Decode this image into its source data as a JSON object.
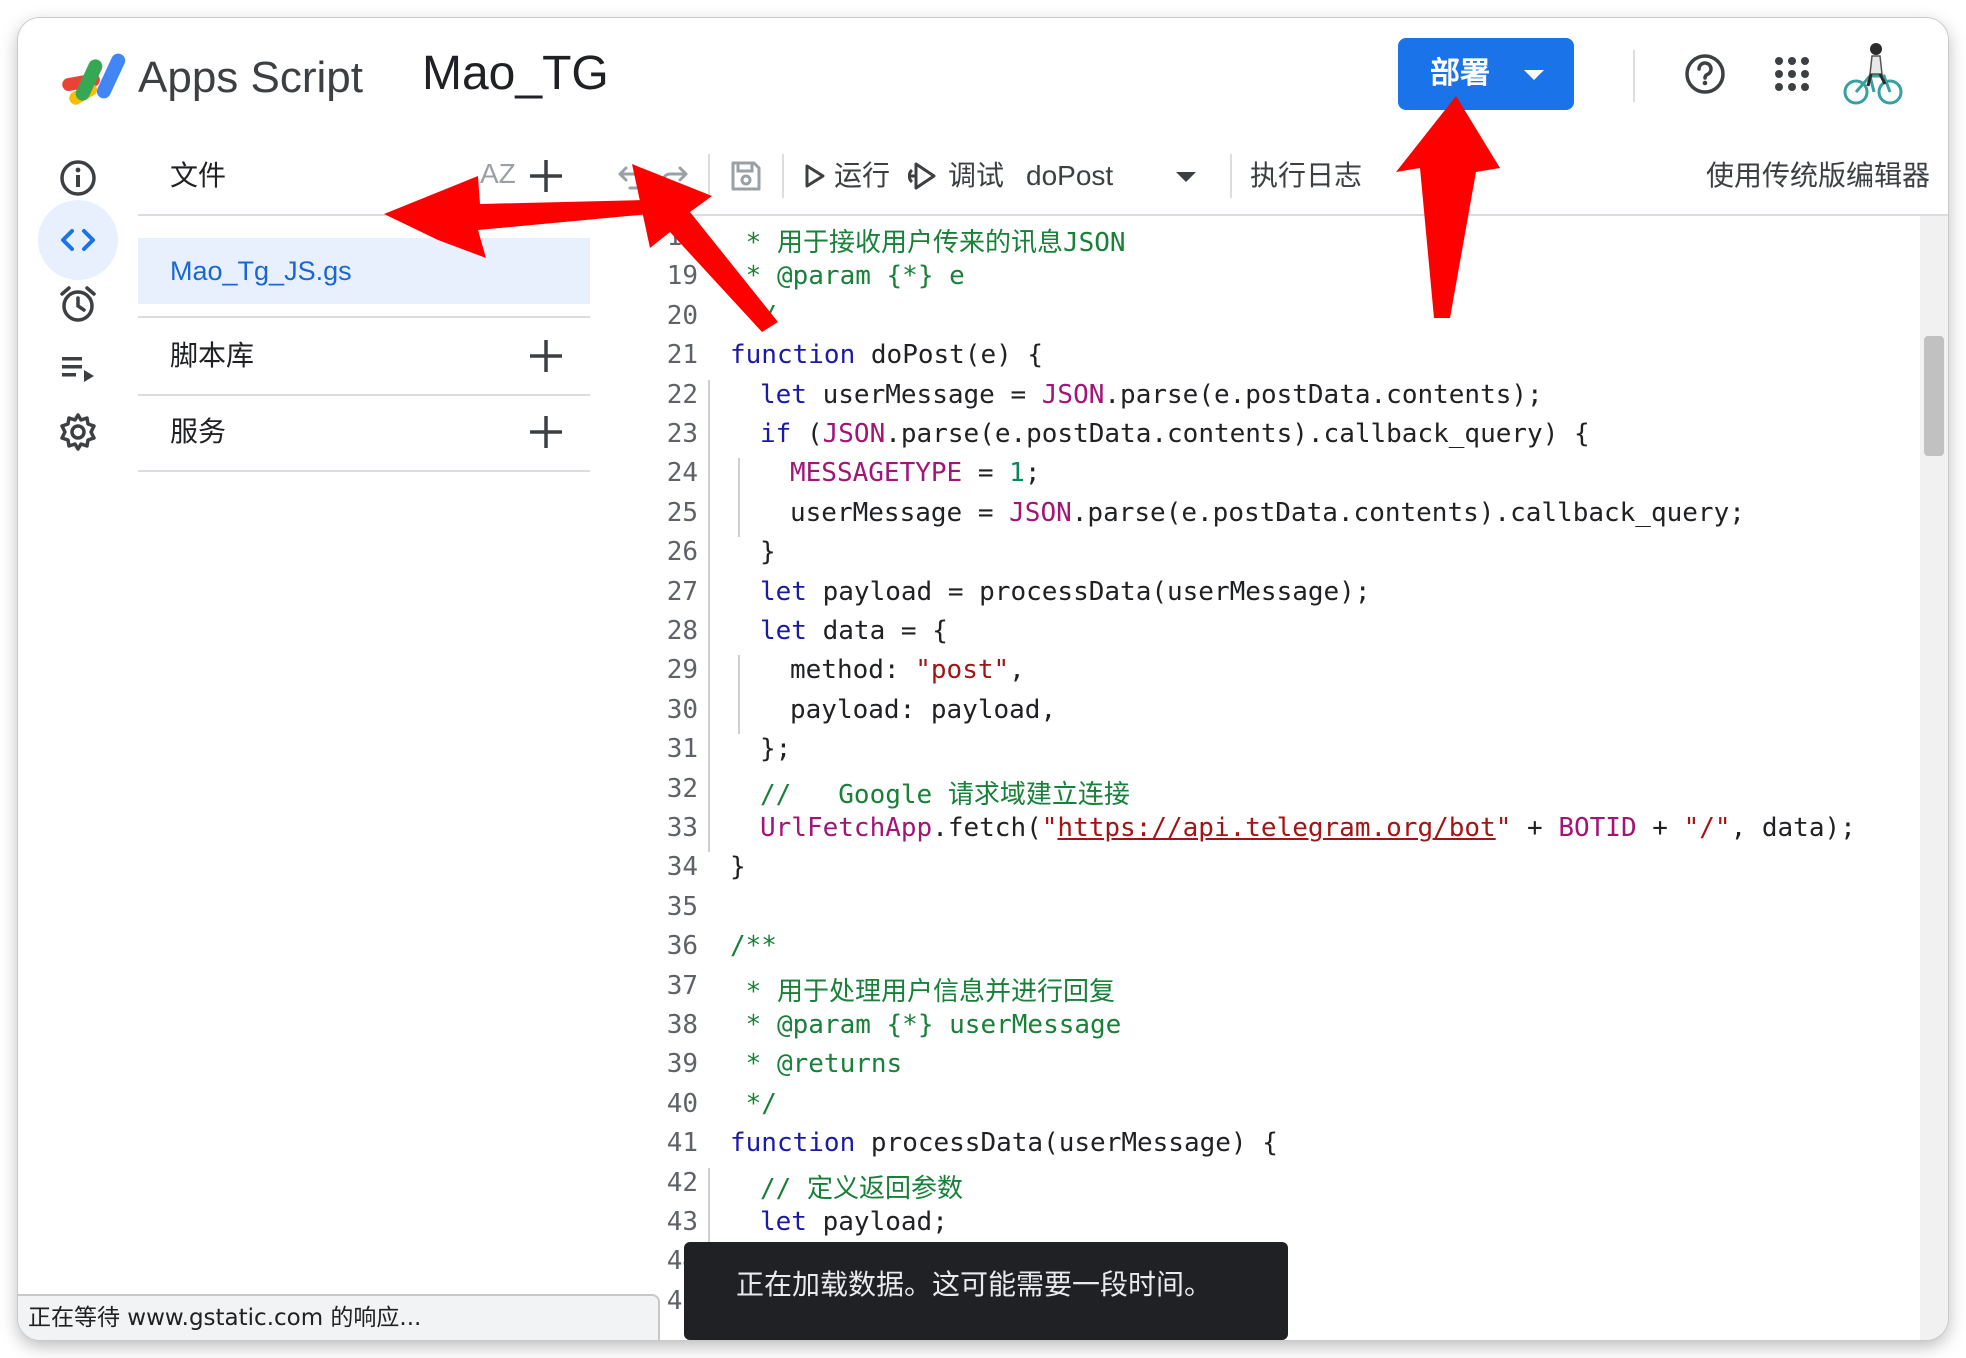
{
  "header": {
    "app_name": "Apps Script",
    "project_name": "Mao_TG",
    "deploy_label": "部署",
    "brand_color": "#1a73e8",
    "icons": [
      "apps-script-logo",
      "deploy-dropdown-icon",
      "help-icon",
      "apps-grid-icon",
      "avatar"
    ]
  },
  "rail": {
    "items": [
      {
        "name": "overview",
        "icon": "info-icon"
      },
      {
        "name": "editor",
        "icon": "code-icon",
        "active": true
      },
      {
        "name": "triggers",
        "icon": "alarm-icon"
      },
      {
        "name": "executions",
        "icon": "executions-icon"
      },
      {
        "name": "settings",
        "icon": "gear-icon"
      }
    ]
  },
  "files": {
    "title": "文件",
    "sort_label": "AZ",
    "items": [
      {
        "name": "Mao_Tg_JS.gs",
        "selected": true
      }
    ],
    "libraries_label": "脚本库",
    "services_label": "服务"
  },
  "toolbar": {
    "run_label": "运行",
    "debug_label": "调试",
    "function_select": "doPost",
    "logs_label": "执行日志",
    "legacy_label": "使用传统版编辑器"
  },
  "editor": {
    "lines": [
      {
        "n": "18",
        "indent": 0,
        "segments": [
          {
            "t": " * 用于接收用户传来的讯息JSON",
            "c": "gr"
          }
        ]
      },
      {
        "n": "19",
        "indent": 0,
        "segments": [
          {
            "t": " * @param {*} e",
            "c": "gr"
          }
        ]
      },
      {
        "n": "20",
        "indent": 0,
        "segments": [
          {
            "t": " */",
            "c": "gr"
          }
        ]
      },
      {
        "n": "21",
        "indent": 0,
        "segments": [
          {
            "t": "function",
            "c": "kw"
          },
          {
            "t": " doPost(e) {",
            "c": ""
          }
        ]
      },
      {
        "n": "22",
        "indent": 1,
        "segments": [
          {
            "t": "let",
            "c": "kw"
          },
          {
            "t": " userMessage = ",
            "c": ""
          },
          {
            "t": "JSON",
            "c": "mg"
          },
          {
            "t": ".parse(e.postData.contents);",
            "c": ""
          }
        ]
      },
      {
        "n": "23",
        "indent": 1,
        "segments": [
          {
            "t": "if",
            "c": "kw"
          },
          {
            "t": " (",
            "c": ""
          },
          {
            "t": "JSON",
            "c": "mg"
          },
          {
            "t": ".parse(e.postData.contents).callback_query) {",
            "c": ""
          }
        ]
      },
      {
        "n": "24",
        "indent": 2,
        "segments": [
          {
            "t": "MESSAGETYPE",
            "c": "mg"
          },
          {
            "t": " = ",
            "c": ""
          },
          {
            "t": "1",
            "c": "nm"
          },
          {
            "t": ";",
            "c": ""
          }
        ]
      },
      {
        "n": "25",
        "indent": 2,
        "segments": [
          {
            "t": "userMessage = ",
            "c": ""
          },
          {
            "t": "JSON",
            "c": "mg"
          },
          {
            "t": ".parse(e.postData.contents).callback_query;",
            "c": ""
          }
        ]
      },
      {
        "n": "26",
        "indent": 1,
        "segments": [
          {
            "t": "}",
            "c": ""
          }
        ]
      },
      {
        "n": "27",
        "indent": 1,
        "segments": [
          {
            "t": "let",
            "c": "kw"
          },
          {
            "t": " payload = processData(userMessage);",
            "c": ""
          }
        ]
      },
      {
        "n": "28",
        "indent": 1,
        "segments": [
          {
            "t": "let",
            "c": "kw"
          },
          {
            "t": " data = {",
            "c": ""
          }
        ]
      },
      {
        "n": "29",
        "indent": 2,
        "segments": [
          {
            "t": "method: ",
            "c": ""
          },
          {
            "t": "\"post\"",
            "c": "st"
          },
          {
            "t": ",",
            "c": ""
          }
        ]
      },
      {
        "n": "30",
        "indent": 2,
        "segments": [
          {
            "t": "payload: payload,",
            "c": ""
          }
        ]
      },
      {
        "n": "31",
        "indent": 1,
        "segments": [
          {
            "t": "};",
            "c": ""
          }
        ]
      },
      {
        "n": "32",
        "indent": 1,
        "segments": [
          {
            "t": "//   Google 请求域建立连接",
            "c": "gr"
          }
        ]
      },
      {
        "n": "33",
        "indent": 1,
        "segments": [
          {
            "t": "UrlFetchApp",
            "c": "mg"
          },
          {
            "t": ".fetch(",
            "c": ""
          },
          {
            "t": "\"",
            "c": "st"
          },
          {
            "t": "https://api.telegram.org/bot",
            "c": "url"
          },
          {
            "t": "\"",
            "c": "st"
          },
          {
            "t": " + ",
            "c": ""
          },
          {
            "t": "BOTID",
            "c": "mg"
          },
          {
            "t": " + ",
            "c": ""
          },
          {
            "t": "\"/\"",
            "c": "st"
          },
          {
            "t": ", data);",
            "c": ""
          }
        ]
      },
      {
        "n": "34",
        "indent": 0,
        "segments": [
          {
            "t": "}",
            "c": ""
          }
        ]
      },
      {
        "n": "35",
        "indent": 0,
        "segments": []
      },
      {
        "n": "36",
        "indent": 0,
        "segments": [
          {
            "t": "/**",
            "c": "gr"
          }
        ]
      },
      {
        "n": "37",
        "indent": 0,
        "segments": [
          {
            "t": " * 用于处理用户信息并进行回复",
            "c": "gr"
          }
        ]
      },
      {
        "n": "38",
        "indent": 0,
        "segments": [
          {
            "t": " * @param {*} userMessage",
            "c": "gr"
          }
        ]
      },
      {
        "n": "39",
        "indent": 0,
        "segments": [
          {
            "t": " * @returns",
            "c": "gr"
          }
        ]
      },
      {
        "n": "40",
        "indent": 0,
        "segments": [
          {
            "t": " */",
            "c": "gr"
          }
        ]
      },
      {
        "n": "41",
        "indent": 0,
        "segments": [
          {
            "t": "function",
            "c": "kw"
          },
          {
            "t": " processData(userMessage) {",
            "c": ""
          }
        ]
      },
      {
        "n": "42",
        "indent": 1,
        "segments": [
          {
            "t": "// 定义返回参数",
            "c": "gr"
          }
        ]
      },
      {
        "n": "43",
        "indent": 1,
        "segments": [
          {
            "t": "let",
            "c": "kw"
          },
          {
            "t": " payload;",
            "c": ""
          }
        ]
      },
      {
        "n": "44",
        "indent": 1,
        "segments": []
      },
      {
        "n": "45",
        "indent": 1,
        "segments": []
      }
    ]
  },
  "status_bar": {
    "text": "正在等待 www.gstatic.com 的响应..."
  },
  "toast": {
    "text": "正在加载数据。这可能需要一段时间。"
  },
  "annotations": {
    "arrow_color": "#ff0000"
  }
}
